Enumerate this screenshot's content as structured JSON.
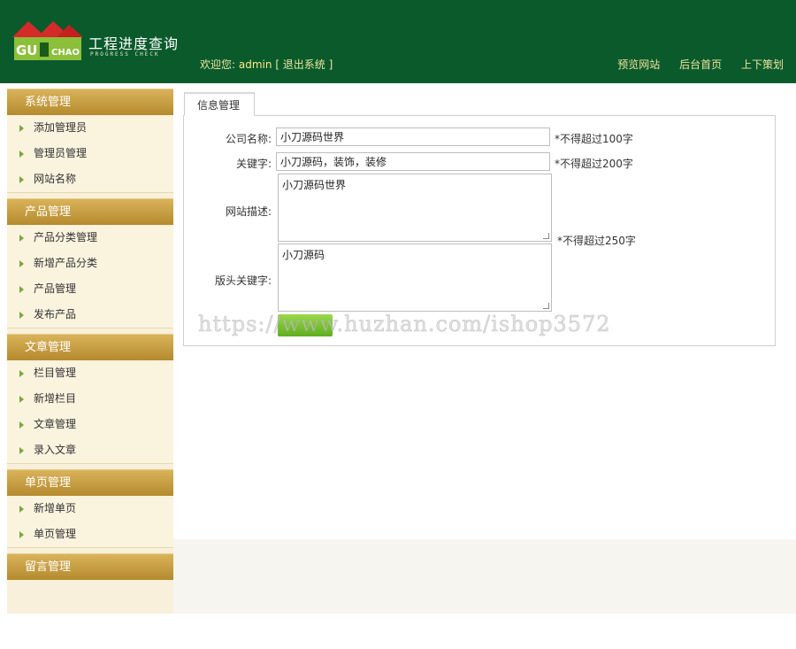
{
  "header": {
    "logo_text": "GUOCHAO",
    "title": "工程进度查询",
    "subtitle": "PROGRESS CHECK",
    "welcome_prefix": "欢迎您:",
    "username": "admin",
    "logout": "[ 退出系统 ]",
    "links": [
      "预览网站",
      "后台首页",
      "上下策划"
    ]
  },
  "sidebar": {
    "groups": [
      {
        "title": "系统管理",
        "items": [
          "添加管理员",
          "管理员管理",
          "网站名称"
        ]
      },
      {
        "title": "产品管理",
        "items": [
          "产品分类管理",
          "新增产品分类",
          "产品管理",
          "发布产品"
        ]
      },
      {
        "title": "文章管理",
        "items": [
          "栏目管理",
          "新增栏目",
          "文章管理",
          "录入文章"
        ]
      },
      {
        "title": "单页管理",
        "items": [
          "新增单页",
          "单页管理"
        ]
      },
      {
        "title": "留言管理",
        "items": []
      }
    ]
  },
  "main": {
    "tab_label": "信息管理",
    "form": {
      "company_label": "公司名称:",
      "company_value": "小刀源码世界",
      "company_hint": "*不得超过100字",
      "keywords_label": "关键字:",
      "keywords_value": "小刀源码，装饰，装修",
      "keywords_hint": "*不得超过200字",
      "desc_label": "网站描述:",
      "desc_value": "小刀源码世界",
      "desc_hint": "*不得超过250字",
      "head_kw_label": "版头关键字:",
      "head_kw_value": "小刀源码"
    },
    "watermark": "https://www.huzhan.com/ishop3572"
  },
  "colors": {
    "header_bg": "#0a5a2c",
    "sidebar_head": "#c89a3e",
    "sidebar_bg": "#faf3de",
    "accent_green": "#7aa83a"
  }
}
